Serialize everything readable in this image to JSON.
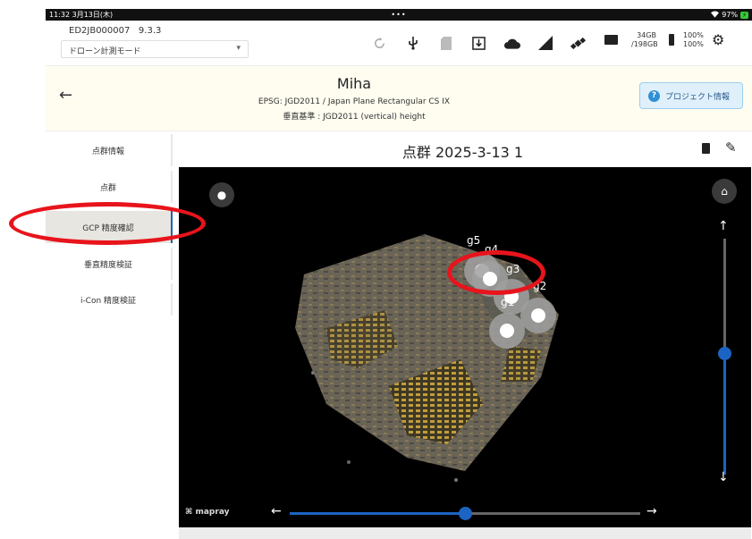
{
  "statusbar": {
    "time": "11:32",
    "date": "3月13日(木)",
    "center_dots": "•••",
    "wifi_icon": "wifi-icon",
    "battery_percent": "97%",
    "charging_icon": "bolt-icon"
  },
  "toolbar": {
    "device_id": "ED2JB000007",
    "version": "9.3.3",
    "mode_value": "ドローン計測モード",
    "icons": [
      "refresh-icon",
      "usb-icon",
      "sd-card-icon",
      "download-icon",
      "cloud-icon",
      "signal-icon",
      "satellite-icon",
      "folder-icon"
    ],
    "storage_used": "34GB",
    "storage_total": "/198GB",
    "battery_a": "100%",
    "battery_b": "100%"
  },
  "project": {
    "name": "Miha",
    "coordinate_system": "EPSG: JGD2011 / Japan Plane Rectangular CS IX",
    "vertical_datum": "垂直基準 : JGD2011 (vertical) height",
    "info_button": "プロジェクト情報"
  },
  "sidebar": {
    "items": [
      {
        "label": "点群情報",
        "active": false
      },
      {
        "label": "点群",
        "active": false
      },
      {
        "label": "GCP 精度確認",
        "active": true
      },
      {
        "label": "垂直精度検証",
        "active": false
      },
      {
        "label": "i-Con 精度検証",
        "active": false
      }
    ]
  },
  "content": {
    "title": "点群 2025-3-13 1"
  },
  "viewer": {
    "markers": [
      "g5",
      "g4",
      "g3",
      "g2",
      "g1"
    ],
    "brand": "mapray",
    "vertical_slider": 0.5,
    "horizontal_slider": 0.5
  },
  "colors": {
    "accent": "#1c64c4",
    "highlight": "#e8141c",
    "active_nav_bg": "#e8e6e0"
  }
}
